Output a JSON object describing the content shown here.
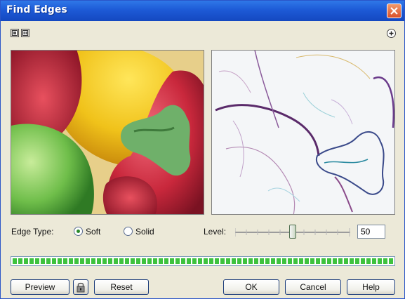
{
  "window": {
    "title": "Find Edges"
  },
  "controls": {
    "edge_type_label": "Edge Type:",
    "edge_type_options": [
      "Soft",
      "Solid"
    ],
    "edge_type_selected": "Soft",
    "level_label": "Level:",
    "level_value": "50"
  },
  "progress": {
    "fraction": 1.0
  },
  "buttons": {
    "preview": "Preview",
    "reset": "Reset",
    "ok": "OK",
    "cancel": "Cancel",
    "help": "Help"
  },
  "icons": {
    "close": "close-icon",
    "view_single": "single-preview-icon",
    "view_dual": "dual-preview-icon",
    "help": "help-icon",
    "lock": "lock-icon"
  },
  "colors": {
    "titlebar": "#1d5ad6",
    "close_button": "#d9502a",
    "progress": "#3ec23e",
    "dialog_bg": "#ece9d8"
  }
}
